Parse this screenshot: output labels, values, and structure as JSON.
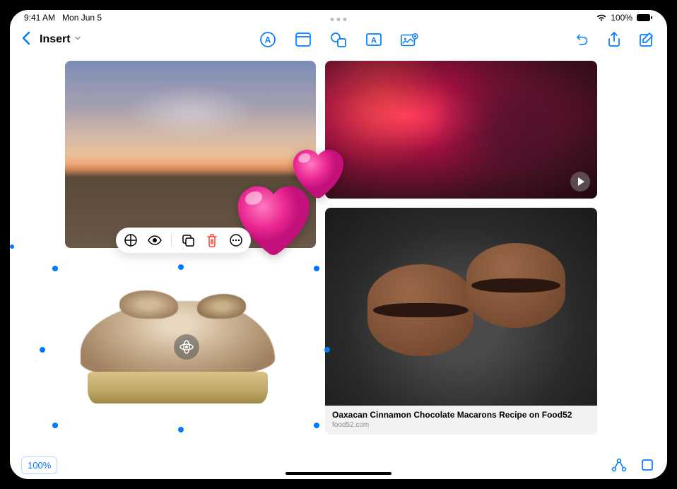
{
  "status": {
    "time": "9:41 AM",
    "date": "Mon Jun 5",
    "battery": "100%"
  },
  "toolbar": {
    "title": "Insert"
  },
  "link": {
    "title": "Oaxacan Cinnamon Chocolate Macarons Recipe on Food52",
    "domain": "food52.com"
  },
  "zoom": {
    "label": "100%"
  },
  "colors": {
    "accent": "#007AFF",
    "destructive": "#FF3B30"
  }
}
